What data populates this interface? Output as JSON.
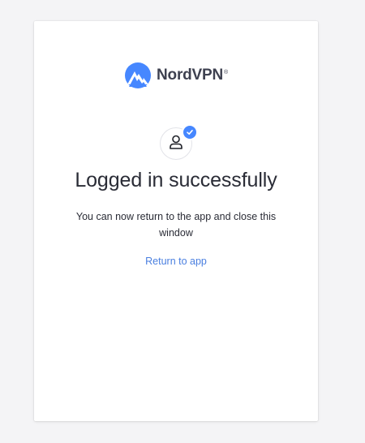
{
  "brand": {
    "name": "NordVPN",
    "registered_mark": "®",
    "logo_color": "#4687ff"
  },
  "status": {
    "title": "Logged in successfully",
    "message": "You can now return to the app and close this window",
    "return_link": "Return to app",
    "badge_color": "#4687ff",
    "link_color": "#4a7fe0"
  },
  "icons": {
    "logo": "nordvpn-mountain-icon",
    "avatar": "user-icon",
    "badge": "check-icon"
  }
}
